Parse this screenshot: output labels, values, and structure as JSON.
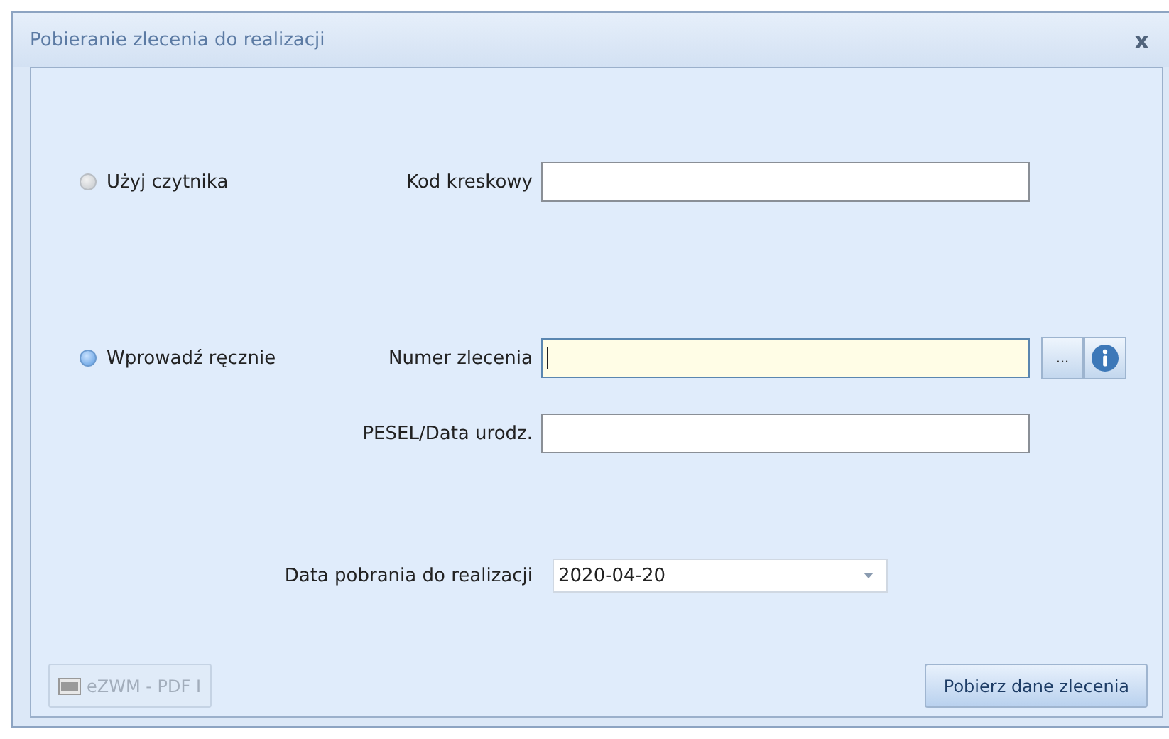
{
  "window": {
    "title": "Pobieranie zlecenia do realizacji",
    "close": "x"
  },
  "modes": [
    {
      "label": "Użyj czytnika",
      "selected": false,
      "fields": [
        {
          "label": "Kod kreskowy",
          "focused": false
        }
      ]
    },
    {
      "label": "Wprowadź ręcznie",
      "selected": true,
      "fields": [
        {
          "label": "Numer zlecenia",
          "focused": true,
          "browse": "..."
        },
        {
          "label": "PESEL/Data urodz.",
          "focused": false
        }
      ]
    }
  ],
  "date": {
    "label": "Data pobrania do realizacji",
    "value": "2020-04-20"
  },
  "buttons": [
    {
      "label": "eZWM - PDF I",
      "disabled": true,
      "kind": "pdf"
    },
    {
      "label": "Pobierz dane zlecenia",
      "disabled": false,
      "kind": "plain"
    }
  ]
}
